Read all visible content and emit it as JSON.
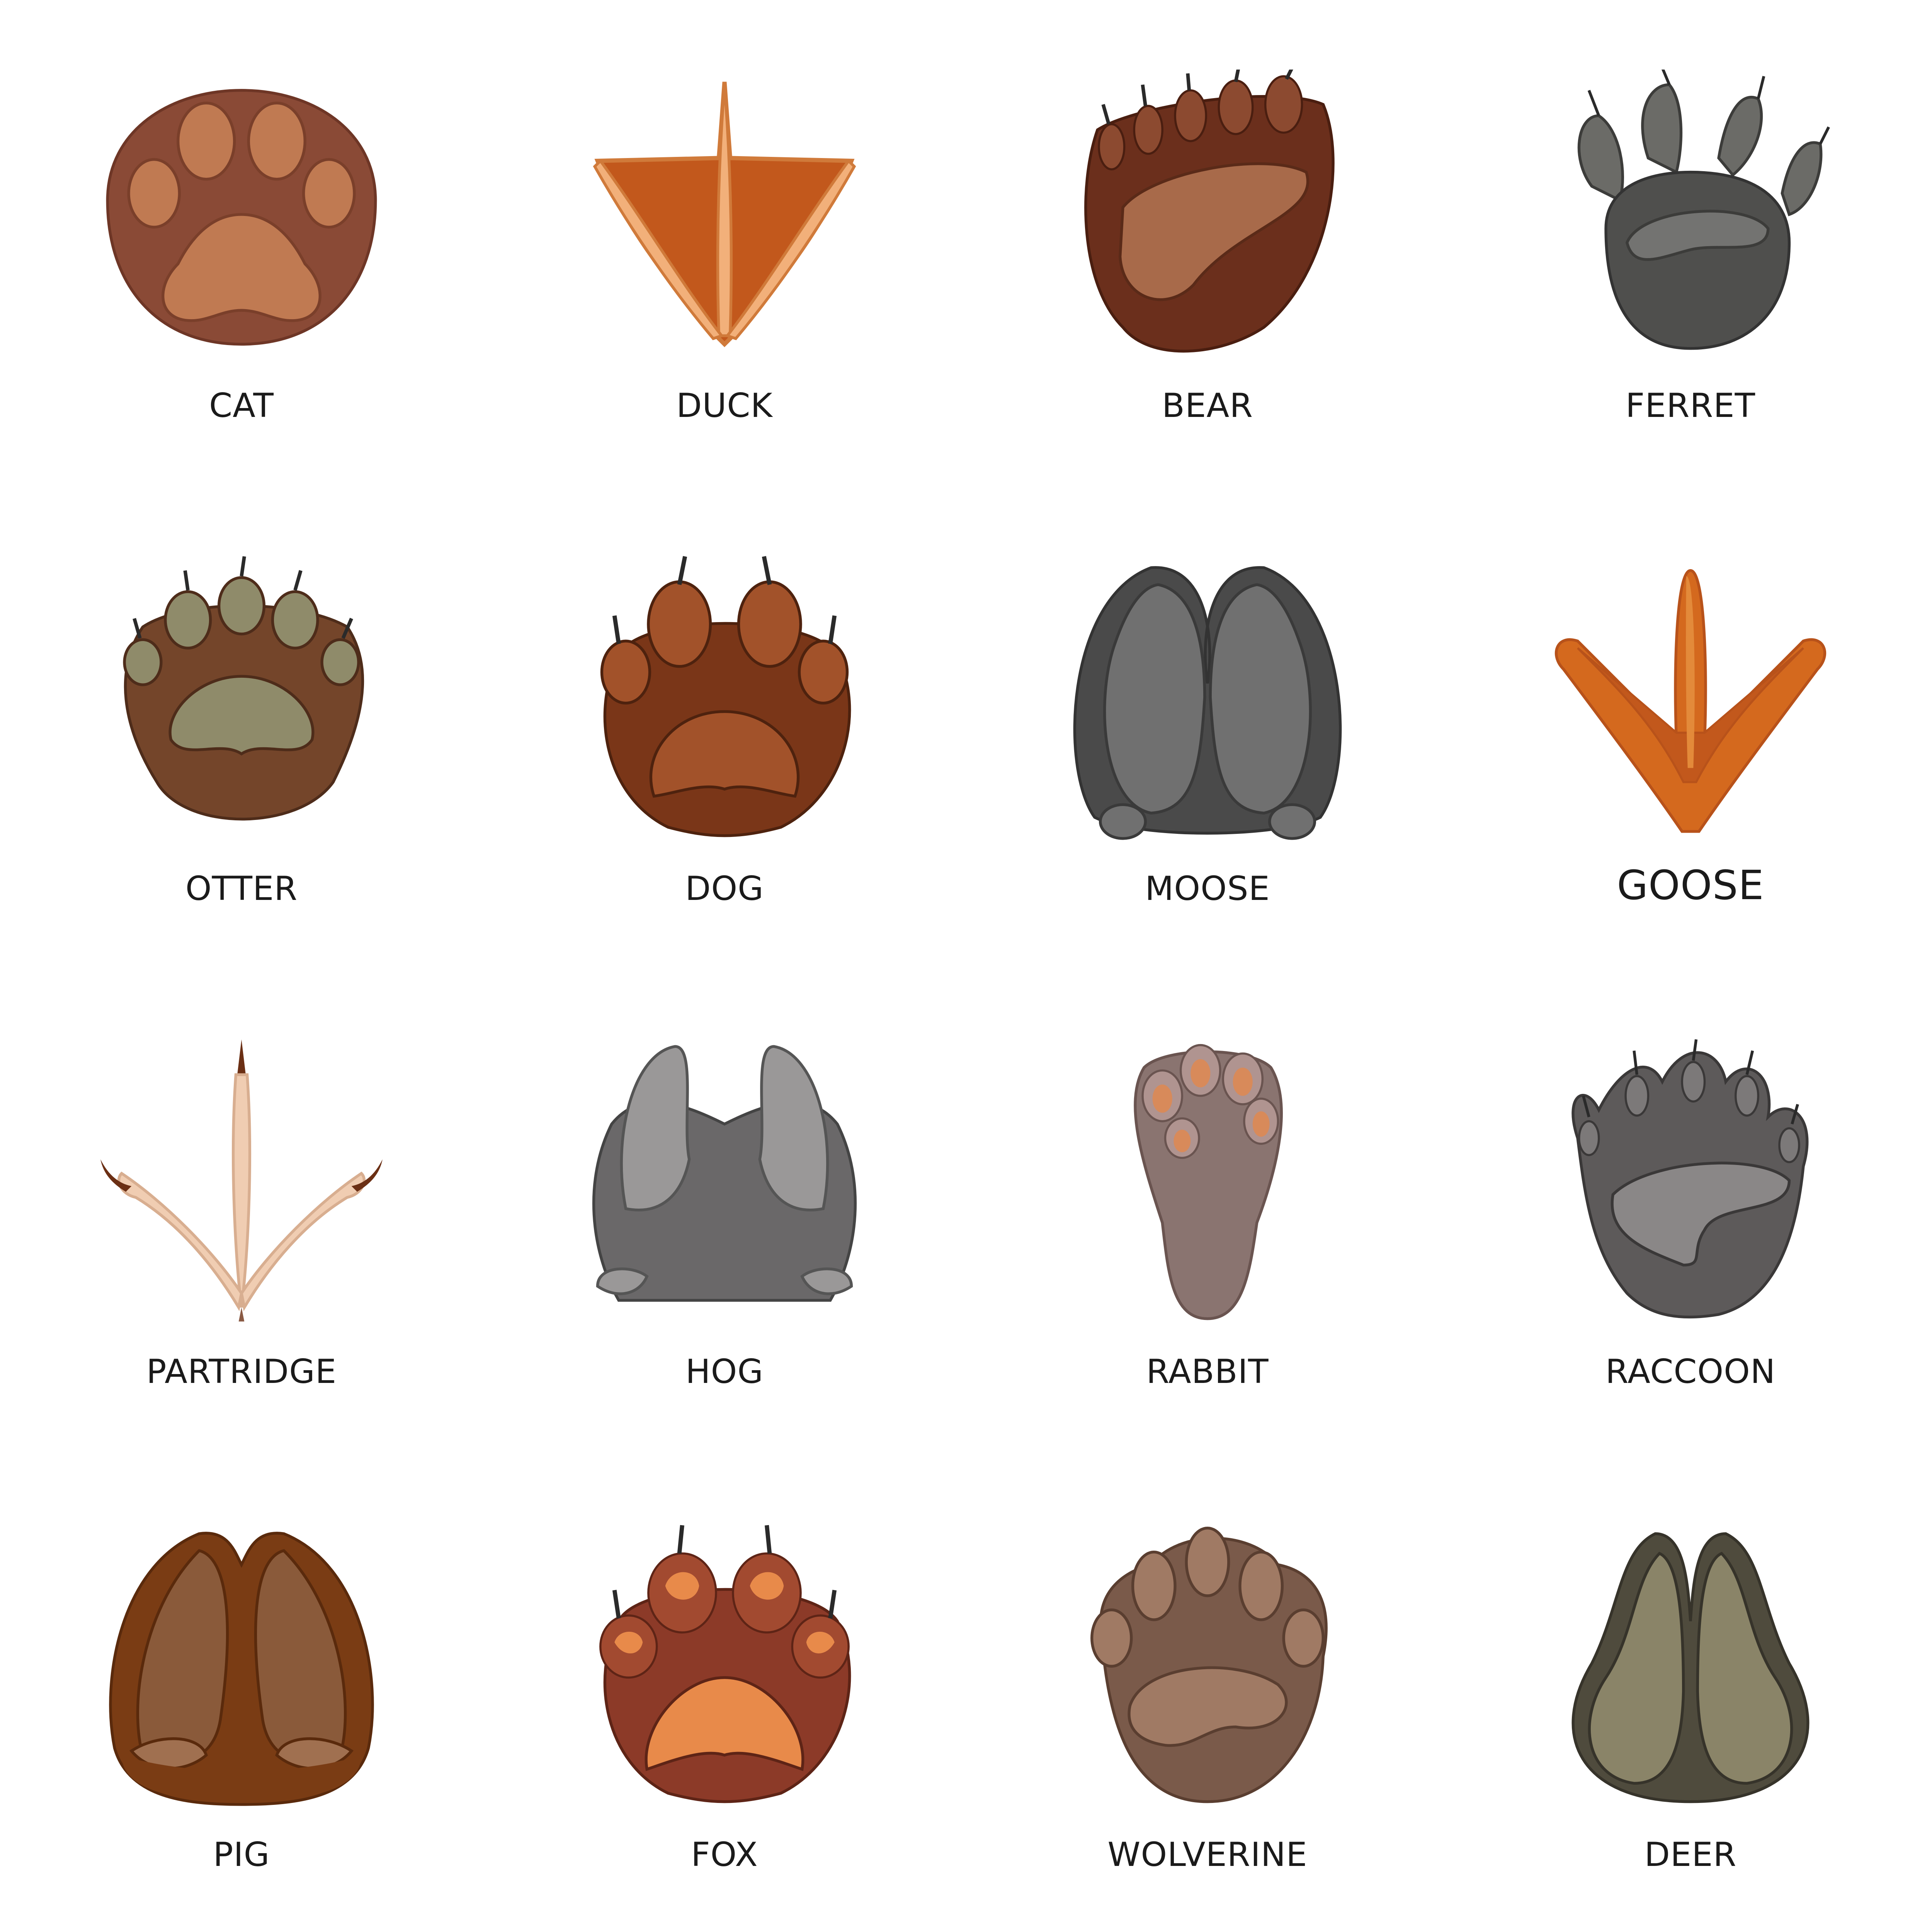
{
  "tracks": [
    {
      "label": "CAT",
      "icon": "cat-paw-print-icon",
      "color": "#8a4a36"
    },
    {
      "label": "DUCK",
      "icon": "duck-webbed-foot-icon",
      "color": "#c2581c"
    },
    {
      "label": "BEAR",
      "icon": "bear-paw-print-icon",
      "color": "#6b2f1c"
    },
    {
      "label": "FERRET",
      "icon": "ferret-paw-print-icon",
      "color": "#4f4f4d"
    },
    {
      "label": "OTTER",
      "icon": "otter-paw-print-icon",
      "color": "#74452a"
    },
    {
      "label": "DOG",
      "icon": "dog-paw-print-icon",
      "color": "#7a3618"
    },
    {
      "label": "MOOSE",
      "icon": "moose-hoof-print-icon",
      "color": "#4a4a4a"
    },
    {
      "label": "GOOSE",
      "icon": "goose-webbed-foot-icon",
      "color": "#d4691e"
    },
    {
      "label": "PARTRIDGE",
      "icon": "partridge-foot-print-icon",
      "color": "#f0cdb2"
    },
    {
      "label": "HOG",
      "icon": "hog-hoof-print-icon",
      "color": "#6a6869"
    },
    {
      "label": "RABBIT",
      "icon": "rabbit-paw-print-icon",
      "color": "#8a7470"
    },
    {
      "label": "RACCOON",
      "icon": "raccoon-paw-print-icon",
      "color": "#5d5a5a"
    },
    {
      "label": "PIG",
      "icon": "pig-hoof-print-icon",
      "color": "#7a3c14"
    },
    {
      "label": "FOX",
      "icon": "fox-paw-print-icon",
      "color": "#8c3a28"
    },
    {
      "label": "WOLVERINE",
      "icon": "wolverine-paw-print-icon",
      "color": "#7a5a4a"
    },
    {
      "label": "DEER",
      "icon": "deer-hoof-print-icon",
      "color": "#4f4b3d"
    }
  ]
}
